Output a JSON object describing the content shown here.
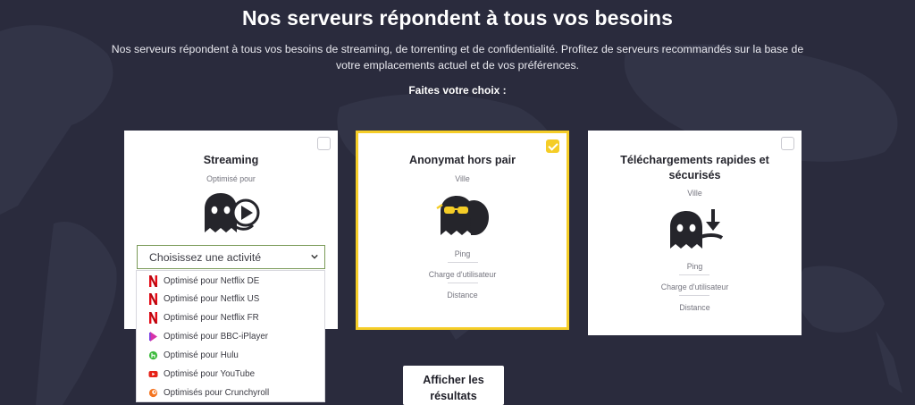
{
  "header": {
    "title": "Nos serveurs répondent à tous vos besoins",
    "subtitle": "Nos serveurs répondent à tous vos besoins de streaming, de torrenting et de confidentialité. Profitez de serveurs recommandés sur la base de votre emplacements actuel et de vos préférences.",
    "choose_label": "Faites votre choix :"
  },
  "cards": [
    {
      "title": "Streaming",
      "subtitle": "Optimisé pour",
      "checked": false,
      "select_placeholder": "Choisissez une activité"
    },
    {
      "title": "Anonymat hors pair",
      "subtitle": "Ville",
      "checked": true,
      "metrics": [
        "Ping",
        "Charge d'utilisateur",
        "Distance"
      ]
    },
    {
      "title": "Téléchargements rapides et sécurisés",
      "subtitle": "Ville",
      "checked": false,
      "metrics": [
        "Ping",
        "Charge d'utilisateur",
        "Distance"
      ]
    }
  ],
  "dropdown": {
    "items": [
      {
        "label": "Optimisé pour Netflix DE",
        "icon": "netflix-icon",
        "color": "#e50914"
      },
      {
        "label": "Optimisé pour Netflix US",
        "icon": "netflix-icon",
        "color": "#e50914"
      },
      {
        "label": "Optimisé pour Netflix FR",
        "icon": "netflix-icon",
        "color": "#e50914"
      },
      {
        "label": "Optimisé pour BBC-iPlayer",
        "icon": "bbc-iplayer-icon",
        "color": "#d633a8"
      },
      {
        "label": "Optimisé pour Hulu",
        "icon": "hulu-icon",
        "color": "#3dbb3d"
      },
      {
        "label": "Optimisé pour YouTube",
        "icon": "youtube-icon",
        "color": "#e62117"
      },
      {
        "label": "Optimisés pour Crunchyroll",
        "icon": "crunchyroll-icon",
        "color": "#f47521"
      }
    ]
  },
  "results_button": {
    "label_line1": "Afficher les",
    "label_line2": "résultats"
  },
  "colors": {
    "background": "#2a2b3d",
    "accent": "#f5cd27",
    "mascot": "#25252b"
  }
}
